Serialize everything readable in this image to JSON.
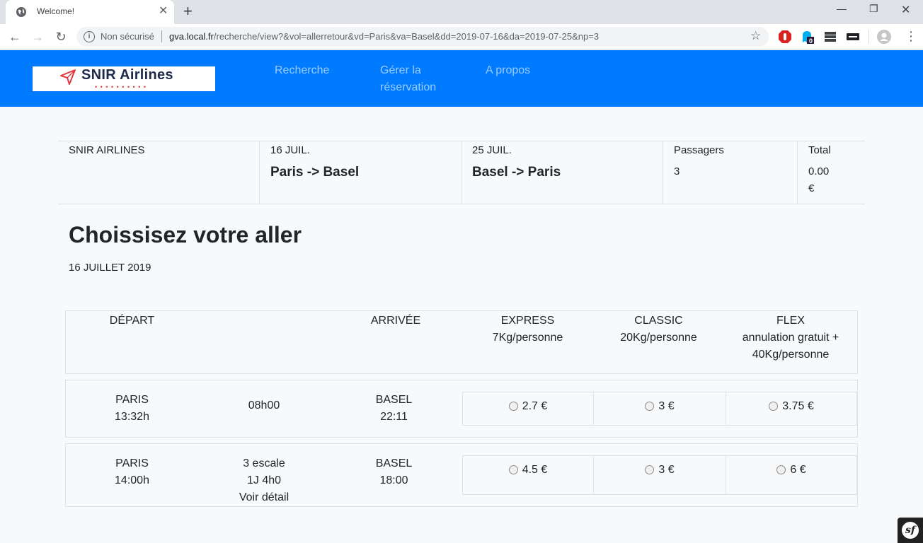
{
  "browser": {
    "tab_title": "Welcome!",
    "insecure_label": "Non sécurisé",
    "url_host": "gva.local.fr",
    "url_path": "/recherche/view?&vol=allerretour&vd=Paris&va=Basel&dd=2019-07-16&da=2019-07-25&np=3",
    "extension_badge": "0"
  },
  "nav": {
    "logo_text": "SNIR  Airlines",
    "logo_dots": "• • • • • • • • • •",
    "links": [
      "Recherche",
      "Gérer la réservation",
      "A propos"
    ]
  },
  "summary": {
    "airline": "SNIR AIRLINES",
    "outbound_date": "16 JUIL.",
    "outbound_route": "Paris -> Basel",
    "return_date": "25 JUIL.",
    "return_route": "Basel -> Paris",
    "passengers_label": "Passagers",
    "passengers_value": "3",
    "total_label": "Total",
    "total_amount": "0.00",
    "total_currency": "€"
  },
  "page": {
    "heading": "Choissisez votre aller",
    "date": "16 JUILLET 2019"
  },
  "table": {
    "headers": {
      "departure": "DÉPART",
      "arrival": "ARRIVÉE",
      "express": "EXPRESS",
      "express_sub": "7Kg/personne",
      "classic": "CLASSIC",
      "classic_sub": "20Kg/personne",
      "flex": "FLEX",
      "flex_sub1": "annulation gratuit +",
      "flex_sub2": "40Kg/personne"
    },
    "rows": [
      {
        "dep_city": "PARIS",
        "dep_time": "13:32h",
        "duration_line1": "08h00",
        "duration_line2": "",
        "duration_line3": "",
        "arr_city": "BASEL",
        "arr_time": "22:11",
        "express": "2.7 €",
        "classic": "3 €",
        "flex": "3.75 €"
      },
      {
        "dep_city": "PARIS",
        "dep_time": "14:00h",
        "duration_line1": "3 escale",
        "duration_line2": "1J 4h0",
        "duration_line3": "Voir détail",
        "arr_city": "BASEL",
        "arr_time": "18:00",
        "express": "4.5 €",
        "classic": "3 €",
        "flex": "6 €"
      }
    ]
  }
}
